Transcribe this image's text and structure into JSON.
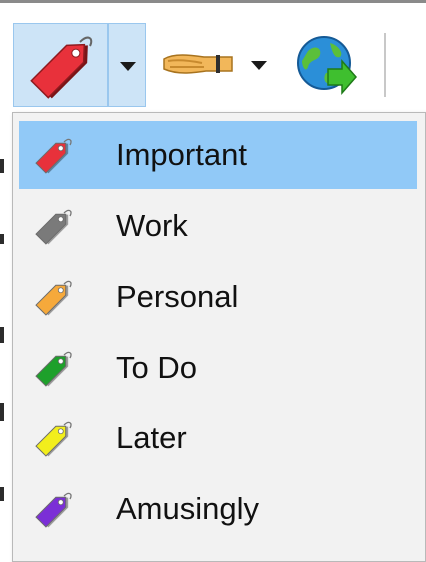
{
  "toolbar": {
    "tag_button": {
      "icon": "tag-icon",
      "color": "#e8313b"
    },
    "tag_dropdown": {
      "icon": "chevron-down-icon"
    },
    "forward_button": {
      "icon": "handshake-icon"
    },
    "forward_dropdown": {
      "icon": "chevron-down-icon"
    },
    "globe_button": {
      "icon": "globe-arrow-icon"
    }
  },
  "tag_menu": {
    "items": [
      {
        "label": "Important",
        "color": "#e8313b",
        "highlighted": true
      },
      {
        "label": "Work",
        "color": "#7a7a7a",
        "highlighted": false
      },
      {
        "label": "Personal",
        "color": "#f6a93b",
        "highlighted": false
      },
      {
        "label": "To Do",
        "color": "#1ea02b",
        "highlighted": false
      },
      {
        "label": "Later",
        "color": "#f2ee1c",
        "highlighted": false
      },
      {
        "label": "Amusingly",
        "color": "#7b2fd6",
        "highlighted": false
      }
    ]
  },
  "colors": {
    "highlight": "#91c9f7",
    "active_button": "#cde4f7",
    "menu_bg": "#f2f2f2"
  }
}
